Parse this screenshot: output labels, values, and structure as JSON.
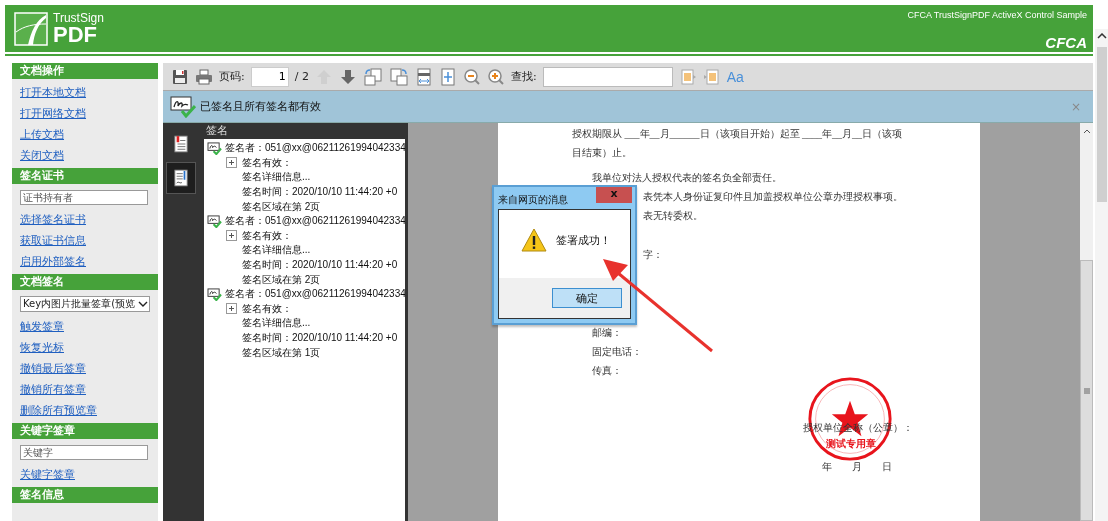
{
  "header": {
    "brand_small": "TrustSign",
    "brand_large": "PDF",
    "caption": "CFCA TrustSignPDF ActiveX Control Sample",
    "logo_text": "CFCA"
  },
  "sidebar": {
    "sections": [
      {
        "title": "文档操作",
        "items": [
          {
            "kind": "link",
            "text": "打开本地文档"
          },
          {
            "kind": "link",
            "text": "打开网络文档"
          },
          {
            "kind": "link",
            "text": "上传文档"
          },
          {
            "kind": "link",
            "text": "关闭文档"
          }
        ]
      },
      {
        "title": "签名证书",
        "items": [
          {
            "kind": "input",
            "text": "证书持有者"
          },
          {
            "kind": "link",
            "text": "选择签名证书"
          },
          {
            "kind": "link",
            "text": "获取证书信息"
          },
          {
            "kind": "link",
            "text": "启用外部签名"
          }
        ]
      },
      {
        "title": "文档签名",
        "items": [
          {
            "kind": "select",
            "text": "Key内图片批量签章(预览"
          },
          {
            "kind": "link",
            "text": "触发签章"
          },
          {
            "kind": "link",
            "text": "恢复光标"
          },
          {
            "kind": "link",
            "text": "撤销最后签章"
          },
          {
            "kind": "link",
            "text": "撤销所有签章"
          },
          {
            "kind": "link",
            "text": "删除所有预览章"
          }
        ]
      },
      {
        "title": "关键字签章",
        "items": [
          {
            "kind": "input",
            "text": "关键字"
          },
          {
            "kind": "link",
            "text": "关键字签章"
          }
        ]
      },
      {
        "title": "签名信息"
      }
    ]
  },
  "toolbar": {
    "page_label": "页码:",
    "page_value": "1",
    "page_total": "/ 2",
    "prev_disabled": true,
    "next_disabled": false,
    "search_label": "查找:",
    "font_button": "Aa"
  },
  "status": {
    "text": "已签名且所有签名都有效",
    "close": "×"
  },
  "panel_tabs": [
    {
      "kind": "bookmarks",
      "selected": false
    },
    {
      "kind": "signatures",
      "selected": true
    }
  ],
  "signatures": {
    "title": "签名",
    "items": [
      {
        "label": "签名者：051@xx@06211261994042334",
        "children": [
          {
            "label": "签名有效：",
            "expanded": false
          },
          {
            "label": "签名详细信息..."
          },
          {
            "label": "签名时间：2020/10/10 11:44:20 +0"
          },
          {
            "label": "签名区域在第 2页"
          }
        ]
      },
      {
        "label": "签名者：051@xx@06211261994042334",
        "children": [
          {
            "label": "签名有效：",
            "expanded": false
          },
          {
            "label": "签名详细信息..."
          },
          {
            "label": "签名时间：2020/10/10 11:44:20 +0"
          },
          {
            "label": "签名区域在第 2页"
          }
        ]
      },
      {
        "label": "签名者：051@xx@06211261994042334",
        "children": [
          {
            "label": "签名有效：",
            "expanded": false
          },
          {
            "label": "签名详细信息..."
          },
          {
            "label": "签名时间：2020/10/10 11:44:20 +0"
          },
          {
            "label": "签名区域在第 1页"
          }
        ]
      }
    ]
  },
  "document": {
    "groups": [
      [
        {
          "kind": "plain",
          "text": "授权期限从 ___年__月______日（该项目开始）起至 ____年__月__日（该项"
        },
        {
          "kind": "plain",
          "text": "目结束）止。"
        }
      ],
      [
        {
          "kind": "indented",
          "text": "我单位对法人授权代表的签名负全部责任。"
        },
        {
          "kind": "covered",
          "text": "表凭本人身份证复印件且加盖授权单位公章办理授权事项。"
        },
        {
          "kind": "covered",
          "text": "表无转委权。"
        }
      ],
      [
        {
          "kind": "covered",
          "text": "字："
        }
      ],
      [
        {
          "kind": "indented",
          "text": "邮编："
        },
        {
          "kind": "indented",
          "text": "固定电话："
        },
        {
          "kind": "indented",
          "text": "传真："
        }
      ]
    ],
    "seal_text": "测试专用章",
    "signature_line": "授权单位全称（公章）：",
    "date_line": "年　　月　　日"
  },
  "dialog": {
    "title": "来自网页的消息",
    "close": "x",
    "message": "签署成功！",
    "button": "确定"
  }
}
